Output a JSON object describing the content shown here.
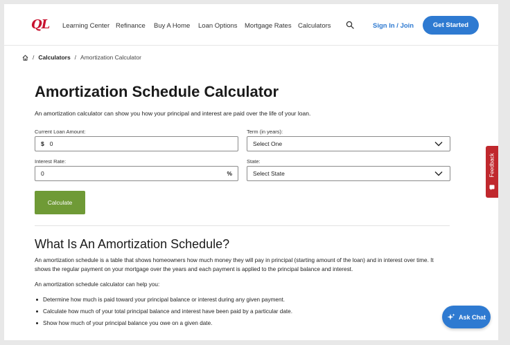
{
  "header": {
    "logo": "QL",
    "nav": [
      "Learning Center",
      "Refinance",
      "Buy A Home",
      "Loan Options",
      "Mortgage Rates",
      "Calculators"
    ],
    "sign_in": "Sign In / Join",
    "cta": "Get Started"
  },
  "breadcrumb": {
    "sep": "/",
    "items": [
      "Calculators",
      "Amortization Calculator"
    ]
  },
  "page": {
    "title": "Amortization Schedule Calculator",
    "intro": "An amortization calculator can show you how your principal and interest are paid over the life of your loan."
  },
  "form": {
    "loan_amount": {
      "label": "Current Loan Amount:",
      "prefix": "$",
      "value": "0"
    },
    "term": {
      "label": "Term (in years):",
      "value": "Select One"
    },
    "interest": {
      "label": "Interest Rate:",
      "value": "0",
      "suffix": "%"
    },
    "state": {
      "label": "State:",
      "value": "Select State"
    },
    "calculate": "Calculate"
  },
  "section": {
    "heading": "What Is An Amortization Schedule?",
    "para": "An amortization schedule is a table that shows homeowners how much money they will pay in principal (starting amount of the loan) and in interest over time. It shows the regular payment on your mortgage over the years and each payment is applied to the principal balance and interest.",
    "para2": "An amortization schedule calculator can help you:",
    "bullets": [
      "Determine how much is paid toward your principal balance or interest during any given payment.",
      "Calculate how much of your total principal balance and interest have been paid by a particular date.",
      "Show how much of your principal balance you owe on a given date."
    ]
  },
  "widgets": {
    "feedback": "Feedback",
    "ask_chat": "Ask Chat"
  },
  "colors": {
    "brand_red": "#c8102e",
    "primary_blue": "#2e7ad1",
    "calc_green": "#6f9a36",
    "feedback_red": "#c0282d"
  },
  "icons": [
    "search-icon",
    "home-icon",
    "chevron-down-icon",
    "feedback-icon",
    "sparkle-icon"
  ]
}
